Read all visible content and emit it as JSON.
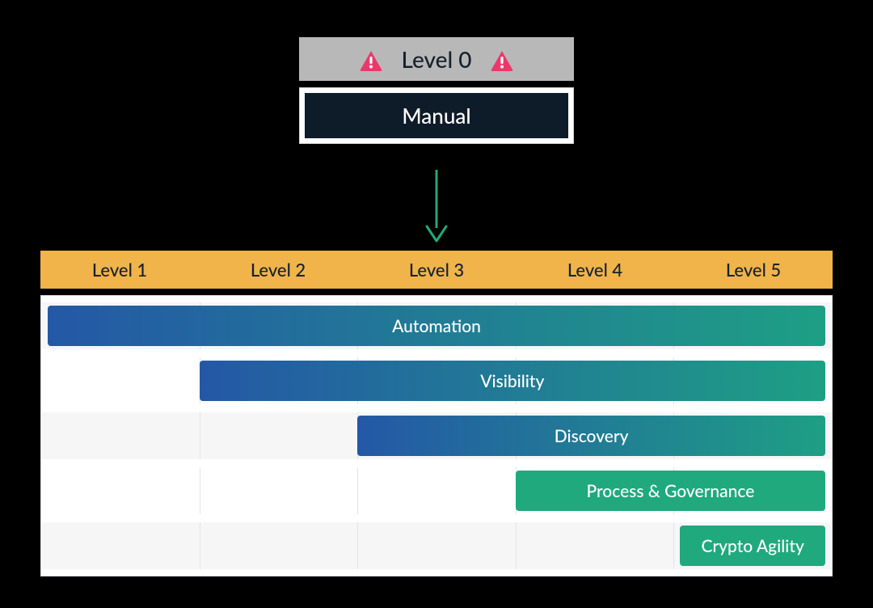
{
  "level0": {
    "title": "Level 0",
    "badge_label": "Manual",
    "warning_icon": "warning-icon"
  },
  "arrow": {
    "direction": "down",
    "color": "#20a97d"
  },
  "levels": [
    "Level 1",
    "Level 2",
    "Level 3",
    "Level 4",
    "Level 5"
  ],
  "bars": [
    {
      "label": "Automation",
      "start": 1,
      "end": 5,
      "style": "gradient"
    },
    {
      "label": "Visibility",
      "start": 2,
      "end": 5,
      "style": "gradient"
    },
    {
      "label": "Discovery",
      "start": 3,
      "end": 5,
      "style": "gradient"
    },
    {
      "label": "Process & Governance",
      "start": 4,
      "end": 5,
      "style": "solid"
    },
    {
      "label": "Crypto Agility",
      "start": 5,
      "end": 5,
      "style": "solid"
    }
  ],
  "colors": {
    "level0_bg": "#b8b8b8",
    "warning": "#e83a6a",
    "manual_bg": "#0e1b29",
    "levels_bg": "#f0b44a",
    "gradient": [
      "#2458a6",
      "#1e9f84"
    ],
    "solid": "#20a97d"
  },
  "chart_data": {
    "type": "bar",
    "orientation": "horizontal-span",
    "categories": [
      "Level 1",
      "Level 2",
      "Level 3",
      "Level 4",
      "Level 5"
    ],
    "series": [
      {
        "name": "Automation",
        "span": [
          1,
          5
        ]
      },
      {
        "name": "Visibility",
        "span": [
          2,
          5
        ]
      },
      {
        "name": "Discovery",
        "span": [
          3,
          5
        ]
      },
      {
        "name": "Process & Governance",
        "span": [
          4,
          5
        ]
      },
      {
        "name": "Crypto Agility",
        "span": [
          5,
          5
        ]
      }
    ],
    "level0": {
      "label": "Level 0",
      "state": "Manual",
      "warning": true
    },
    "title": "",
    "xlabel": "",
    "ylabel": ""
  }
}
